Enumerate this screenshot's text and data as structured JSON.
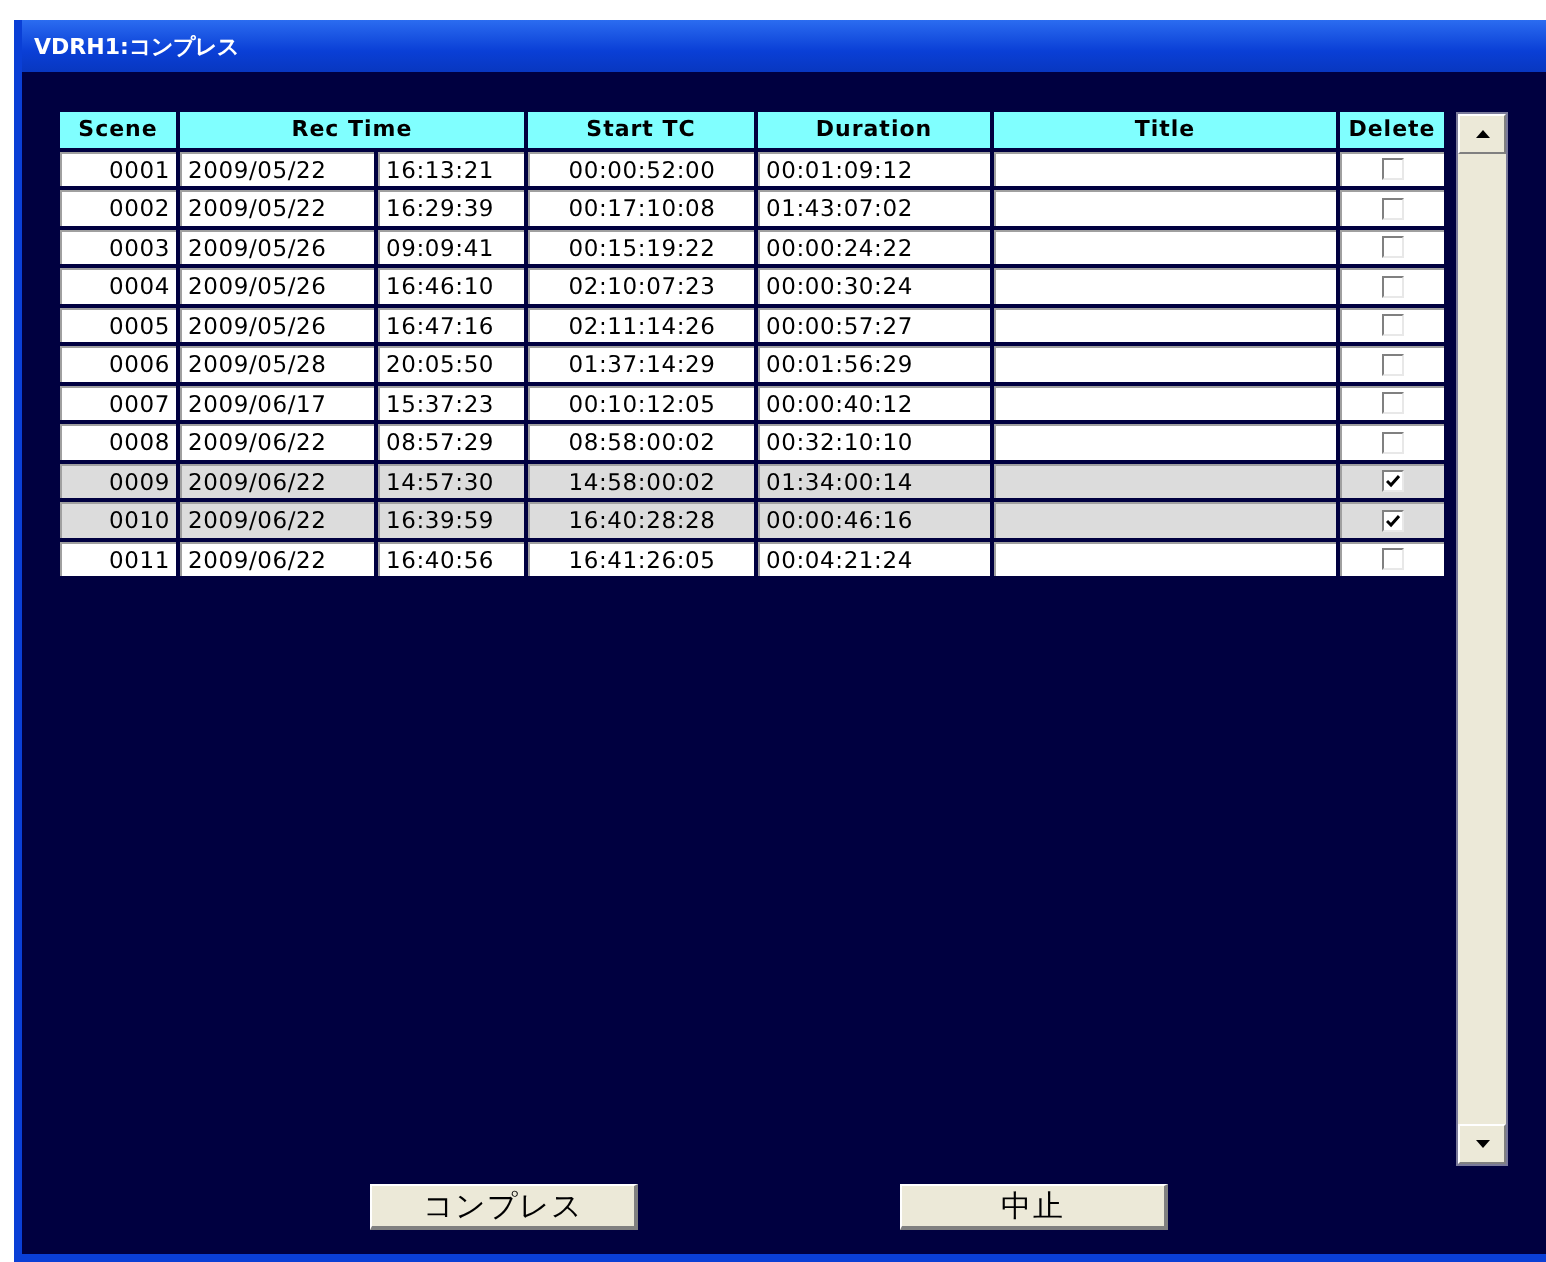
{
  "window": {
    "title": "VDRH1:コンプレス"
  },
  "table": {
    "columns": [
      {
        "label": "Scene"
      },
      {
        "label": "Rec Time"
      },
      {
        "label": "Start TC"
      },
      {
        "label": "Duration"
      },
      {
        "label": "Title"
      },
      {
        "label": "Delete"
      }
    ],
    "rows": [
      {
        "scene": "0001",
        "date": "2009/05/22",
        "time": "16:13:21",
        "start_tc": "00:00:52:00",
        "duration": "00:01:09:12",
        "selected": false,
        "checked": false
      },
      {
        "scene": "0002",
        "date": "2009/05/22",
        "time": "16:29:39",
        "start_tc": "00:17:10:08",
        "duration": "01:43:07:02",
        "selected": false,
        "checked": false
      },
      {
        "scene": "0003",
        "date": "2009/05/26",
        "time": "09:09:41",
        "start_tc": "00:15:19:22",
        "duration": "00:00:24:22",
        "selected": false,
        "checked": false
      },
      {
        "scene": "0004",
        "date": "2009/05/26",
        "time": "16:46:10",
        "start_tc": "02:10:07:23",
        "duration": "00:00:30:24",
        "selected": false,
        "checked": false
      },
      {
        "scene": "0005",
        "date": "2009/05/26",
        "time": "16:47:16",
        "start_tc": "02:11:14:26",
        "duration": "00:00:57:27",
        "selected": false,
        "checked": false
      },
      {
        "scene": "0006",
        "date": "2009/05/28",
        "time": "20:05:50",
        "start_tc": "01:37:14:29",
        "duration": "00:01:56:29",
        "selected": false,
        "checked": false
      },
      {
        "scene": "0007",
        "date": "2009/06/17",
        "time": "15:37:23",
        "start_tc": "00:10:12:05",
        "duration": "00:00:40:12",
        "selected": false,
        "checked": false
      },
      {
        "scene": "0008",
        "date": "2009/06/22",
        "time": "08:57:29",
        "start_tc": "08:58:00:02",
        "duration": "00:32:10:10",
        "selected": false,
        "checked": false
      },
      {
        "scene": "0009",
        "date": "2009/06/22",
        "time": "14:57:30",
        "start_tc": "14:58:00:02",
        "duration": "01:34:00:14",
        "selected": true,
        "checked": true
      },
      {
        "scene": "0010",
        "date": "2009/06/22",
        "time": "16:39:59",
        "start_tc": "16:40:28:28",
        "duration": "00:00:46:16",
        "selected": true,
        "checked": true
      },
      {
        "scene": "0011",
        "date": "2009/06/22",
        "time": "16:40:56",
        "start_tc": "16:41:26:05",
        "duration": "00:04:21:24",
        "selected": false,
        "checked": false
      }
    ]
  },
  "buttons": [
    {
      "label": "コンプレス"
    },
    {
      "label": "中止"
    }
  ]
}
